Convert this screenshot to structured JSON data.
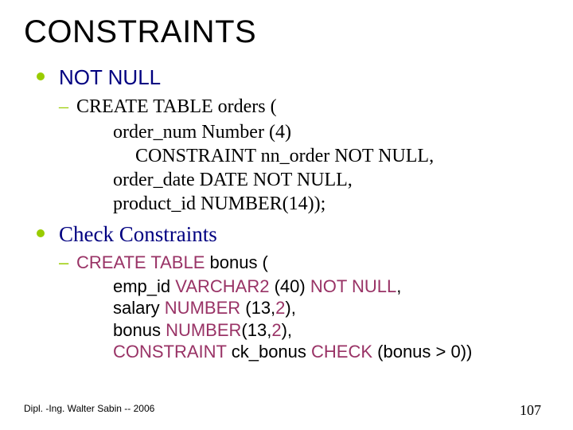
{
  "title": "CONSTRAINTS",
  "section1": {
    "heading": "NOT NULL",
    "dash": "–",
    "intro": "CREATE TABLE orders (",
    "line1": "order_num Number (4)",
    "line2": "CONSTRAINT nn_order NOT NULL,",
    "line3": "order_date DATE NOT NULL,",
    "line4": "product_id NUMBER(14));"
  },
  "section2": {
    "heading": "Check Constraints",
    "dash": "–",
    "intro_a": "CREATE TABLE",
    "intro_b": " bonus (",
    "line1_a": "emp_id ",
    "line1_b": "VARCHAR2",
    "line1_c": " (40) ",
    "line1_d": "NOT NULL",
    "line1_e": ",",
    "line2_a": "salary ",
    "line2_b": "NUMBER",
    "line2_c": " (13,",
    "line2_d": "2",
    "line2_e": "),",
    "line3_a": "bonus  ",
    "line3_b": "NUMBER",
    "line3_c": "(13,",
    "line3_d": "2",
    "line3_e": "),",
    "line4_a": "CONSTRAINT",
    "line4_b": " ck_bonus ",
    "line4_c": "CHECK",
    "line4_d": " (bonus > 0))"
  },
  "footer": {
    "left": "Dipl. -Ing. Walter Sabin  -- 2006",
    "right": "107"
  }
}
